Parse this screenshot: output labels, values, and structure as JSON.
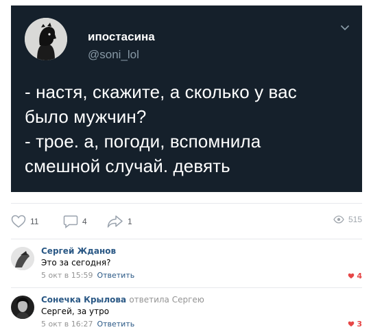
{
  "tweet": {
    "author_name": "ипостасина",
    "author_handle": "@soni_lol",
    "lines": [
      "- настя, скажите, а сколько у вас",
      "было мужчин?",
      "- трое. а, погоди, вспомнила",
      "смешной случай. девять"
    ]
  },
  "actions": {
    "likes": "11",
    "comments": "4",
    "shares": "1",
    "views": "515"
  },
  "comments": [
    {
      "author": "Сергей Жданов",
      "replied_to": "",
      "text": "Это за сегодня?",
      "date": "5 окт в 15:59",
      "reply_label": "Ответить",
      "likes": "4"
    },
    {
      "author": "Сонечка Крылова",
      "replied_to": "ответила Сергею",
      "text": "Сергей, за утро",
      "date": "5 окт в 16:27",
      "reply_label": "Ответить",
      "likes": "3"
    }
  ],
  "colors": {
    "tweet_bg": "#15202b",
    "link": "#2a5885",
    "like_active": "#e64646"
  }
}
